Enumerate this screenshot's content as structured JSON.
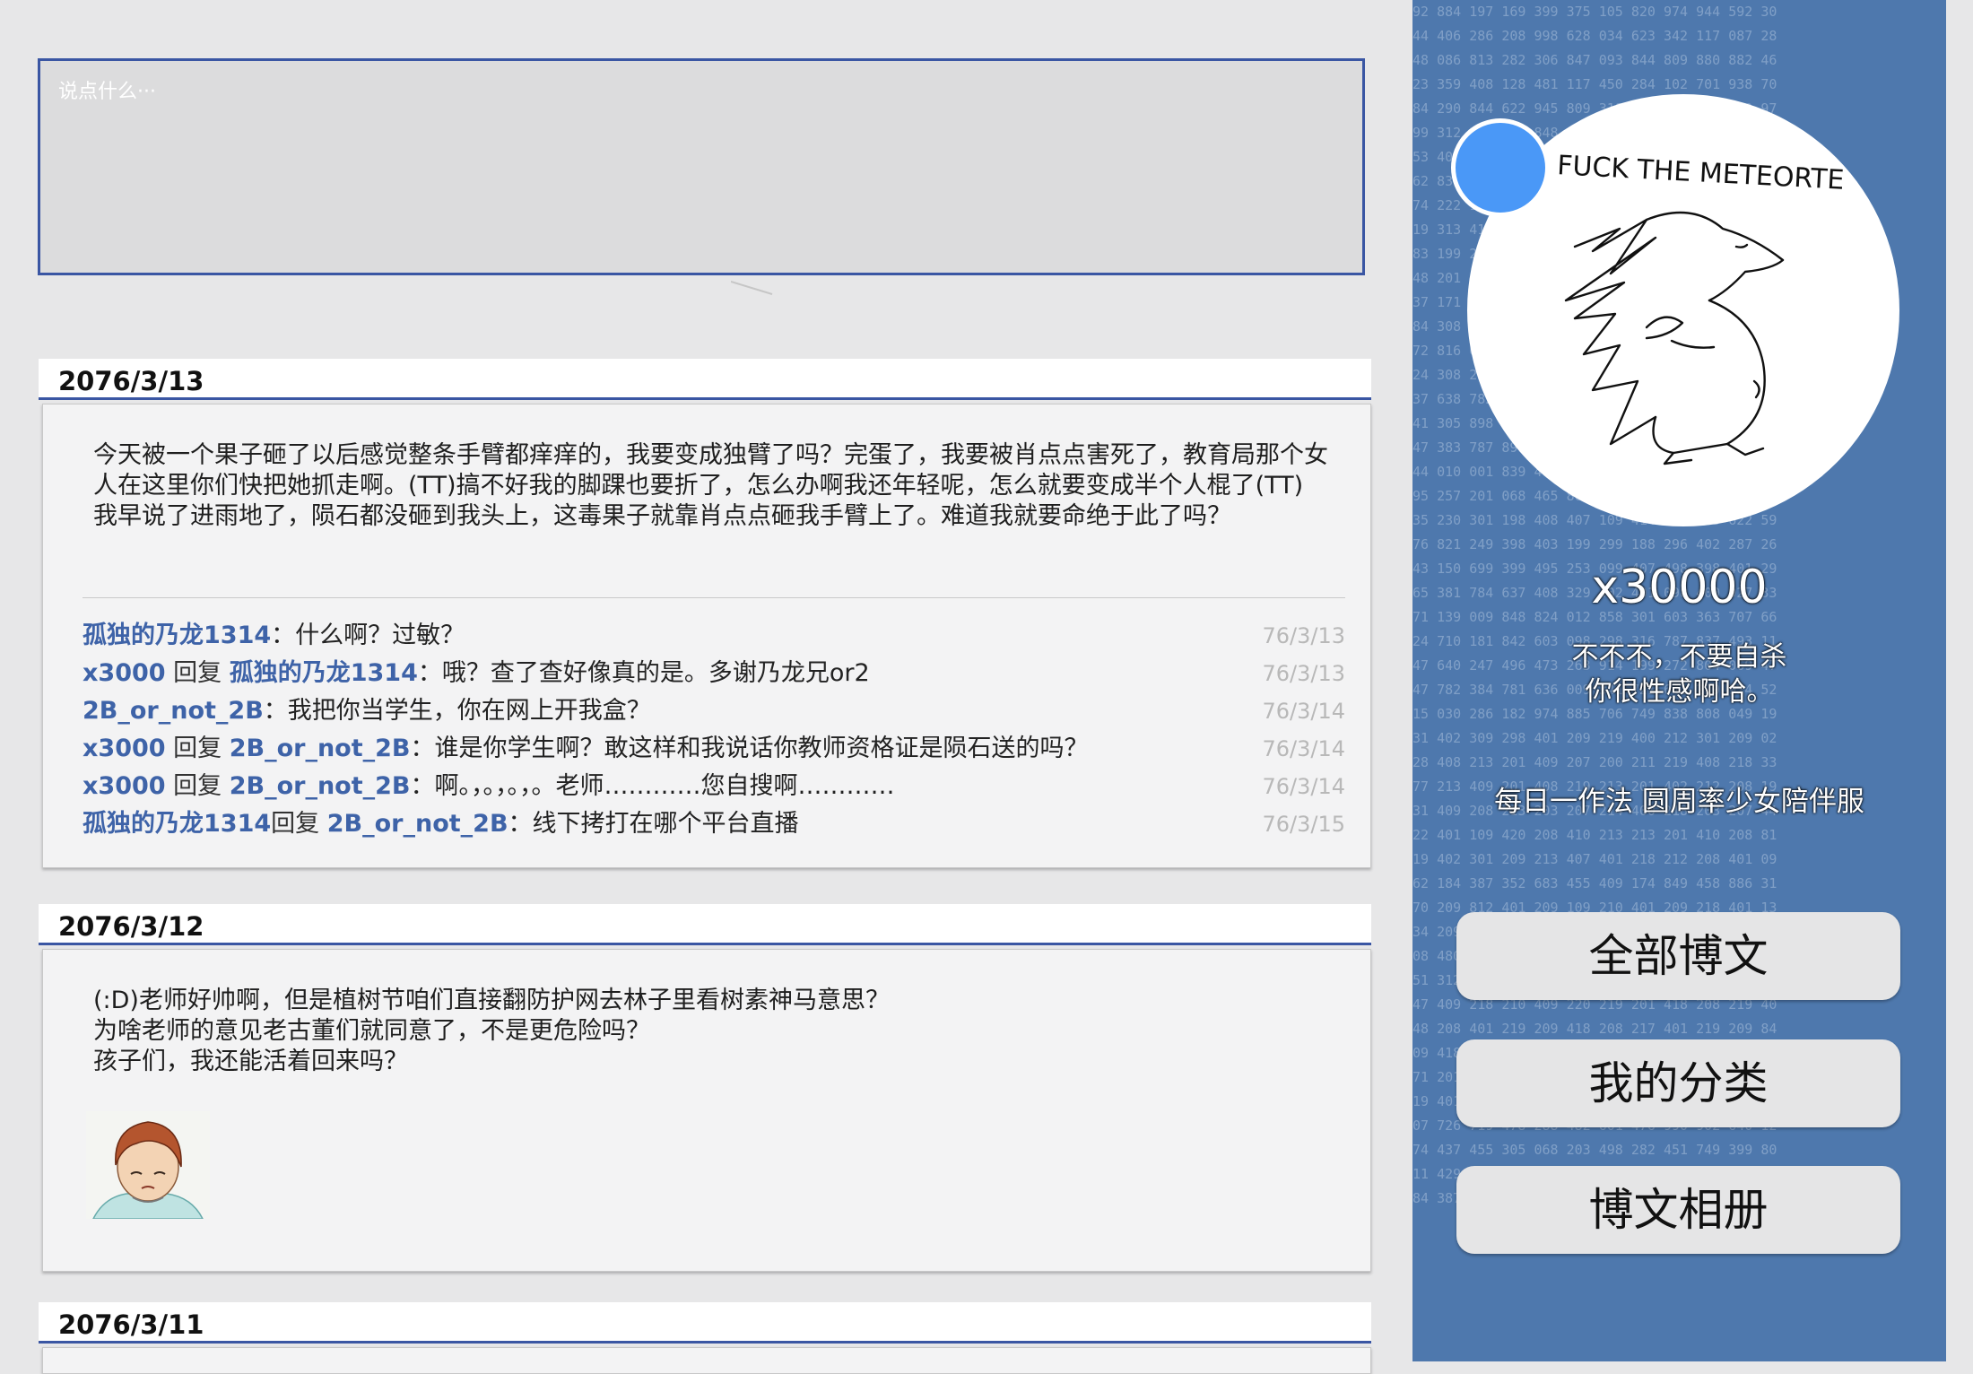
{
  "composer": {
    "placeholder": "说点什么···"
  },
  "entries": [
    {
      "date": "2076/3/13",
      "paragraphs": [
        "今天被一个果子砸了以后感觉整条手臂都痒痒的，我要变成独臂了吗？完蛋了，我要被肖点点害死了，教育局那个女人在这里你们快把她抓走啊。(TT)搞不好我的脚踝也要折了，怎么办啊我还年轻呢，怎么就要变成半个人棍了(TT)",
        "我早说了进雨地了，陨石都没砸到我头上，这毒果子就靠肖点点砸我手臂上了。难道我就要命绝于此了吗？"
      ],
      "comments": [
        {
          "name": "孤独的乃龙1314",
          "reply": "",
          "target": "",
          "text": "：什么啊？过敏？",
          "date": "76/3/13"
        },
        {
          "name": "x3000",
          "reply": " 回复 ",
          "target": "孤独的乃龙1314",
          "text": "：哦？查了查好像真的是。多谢乃龙兄or2",
          "date": "76/3/13"
        },
        {
          "name": "2B_or_not_2B",
          "reply": "",
          "target": "",
          "text": "：我把你当学生，你在网上开我盒？",
          "date": "76/3/14"
        },
        {
          "name": "x3000",
          "reply": " 回复 ",
          "target": "2B_or_not_2B",
          "text": "：谁是你学生啊？敢这样和我说话你教师资格证是陨石送的吗？",
          "date": "76/3/14"
        },
        {
          "name": "x3000",
          "reply": " 回复 ",
          "target": "2B_or_not_2B",
          "text": "：啊。，。，。，。老师…………您自搜啊…………",
          "date": "76/3/14"
        },
        {
          "name": "孤独的乃龙1314",
          "reply": "回复 ",
          "target": "2B_or_not_2B",
          "text": "：线下拷打在哪个平台直播",
          "date": "76/3/15"
        }
      ]
    },
    {
      "date": "2076/3/12",
      "paragraphs": [
        "(:D)老师好帅啊，但是植树节咱们直接翻防护网去林子里看树素神马意思？",
        "为啥老师的意见老古董们就同意了，不是更危险吗？",
        "孩子们，我还能活着回来吗？"
      ]
    },
    {
      "date": "2076/3/11"
    }
  ],
  "profile": {
    "avatar_caption": "FUCK THE METEORTE",
    "username": "x30000",
    "motto_line1": "不不不，不要自杀",
    "motto_line2": "你很性感啊哈。",
    "motto2": "每日一作法  圆周率少女陪伴服"
  },
  "nav": {
    "all_posts": "全部博文",
    "categories": "我的分类",
    "album": "博文相册"
  },
  "colors": {
    "accent": "#3a56a3",
    "link": "#3e63a8",
    "sidebar": "#4e78ad",
    "status": "#4a98f7"
  }
}
